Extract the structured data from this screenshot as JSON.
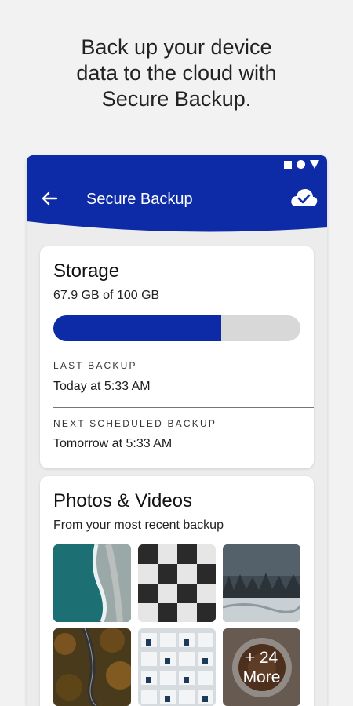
{
  "headline": {
    "line1": "Back up your device",
    "line2": "data to the cloud with",
    "line3": "Secure Backup."
  },
  "appbar": {
    "title": "Secure Backup",
    "back_icon": "arrow-left-icon",
    "cloud_icon": "cloud-check-icon",
    "color": "#0d2ba6"
  },
  "status_bar": {
    "icons": [
      "square-icon",
      "circle-icon",
      "triangle-icon"
    ]
  },
  "storage": {
    "title": "Storage",
    "amount": "67.9 GB of 100 GB",
    "used_fraction": 0.679,
    "bar_color": "#0d2ba6",
    "last_backup_label": "LAST BACKUP",
    "last_backup_value": "Today at 5:33 AM",
    "next_backup_label": "NEXT SCHEDULED BACKUP",
    "next_backup_value": "Tomorrow at 5:33 AM"
  },
  "photos": {
    "title": "Photos & Videos",
    "subtitle": "From your most recent backup",
    "more_line1": "+ 24",
    "more_line2": "More",
    "thumbnails": [
      "aerial-beach-thumbnail",
      "checkerboard-thumbnail",
      "snowy-forest-thumbnail",
      "autumn-road-thumbnail",
      "building-facade-thumbnail",
      "coffee-cup-thumbnail"
    ]
  }
}
